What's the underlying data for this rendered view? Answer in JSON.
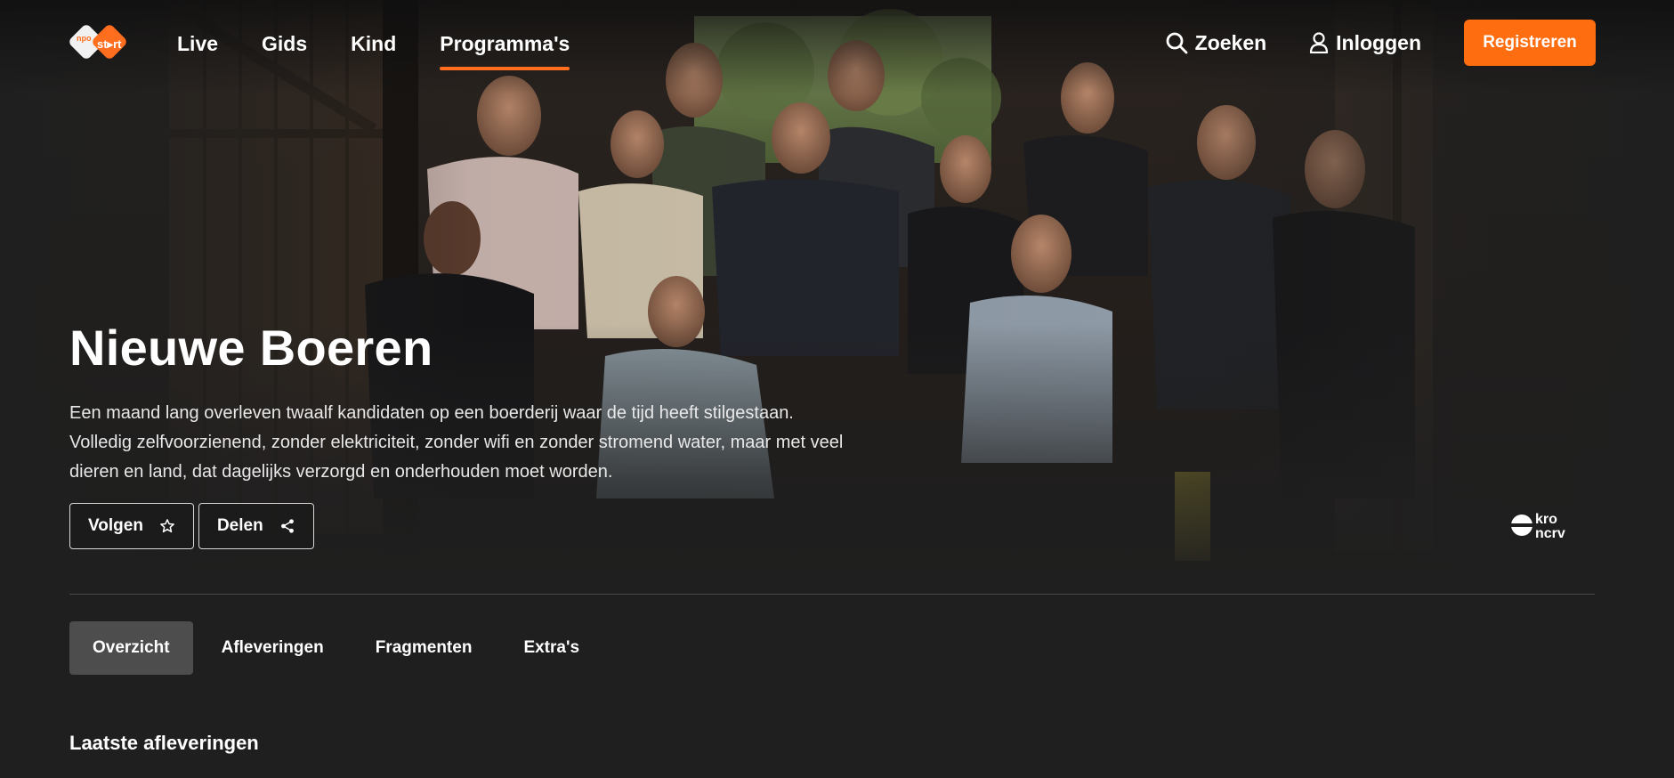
{
  "header": {
    "logo_text": "NPO start",
    "nav": [
      {
        "label": "Live"
      },
      {
        "label": "Gids"
      },
      {
        "label": "Kind"
      },
      {
        "label": "Programma's",
        "active": true
      }
    ],
    "search_label": "Zoeken",
    "login_label": "Inloggen",
    "register_label": "Registreren",
    "accent_color": "#ff6d1f"
  },
  "hero": {
    "title": "Nieuwe Boeren",
    "description": "Een maand lang overleven twaalf kandidaten op een boerderij waar de tijd heeft stilgestaan. Volledig zelfvoorzienend, zonder elektriciteit, zonder wifi en zonder stromend water, maar met veel dieren en land, dat dagelijks verzorgd en onderhouden moet worden.",
    "follow_label": "Volgen",
    "share_label": "Delen",
    "broadcaster": "kro ncrv",
    "image_icon": "group-photo"
  },
  "tabs": [
    {
      "label": "Overzicht",
      "active": true
    },
    {
      "label": "Afleveringen"
    },
    {
      "label": "Fragmenten"
    },
    {
      "label": "Extra's"
    }
  ],
  "sections": {
    "latest_title": "Laatste afleveringen"
  }
}
